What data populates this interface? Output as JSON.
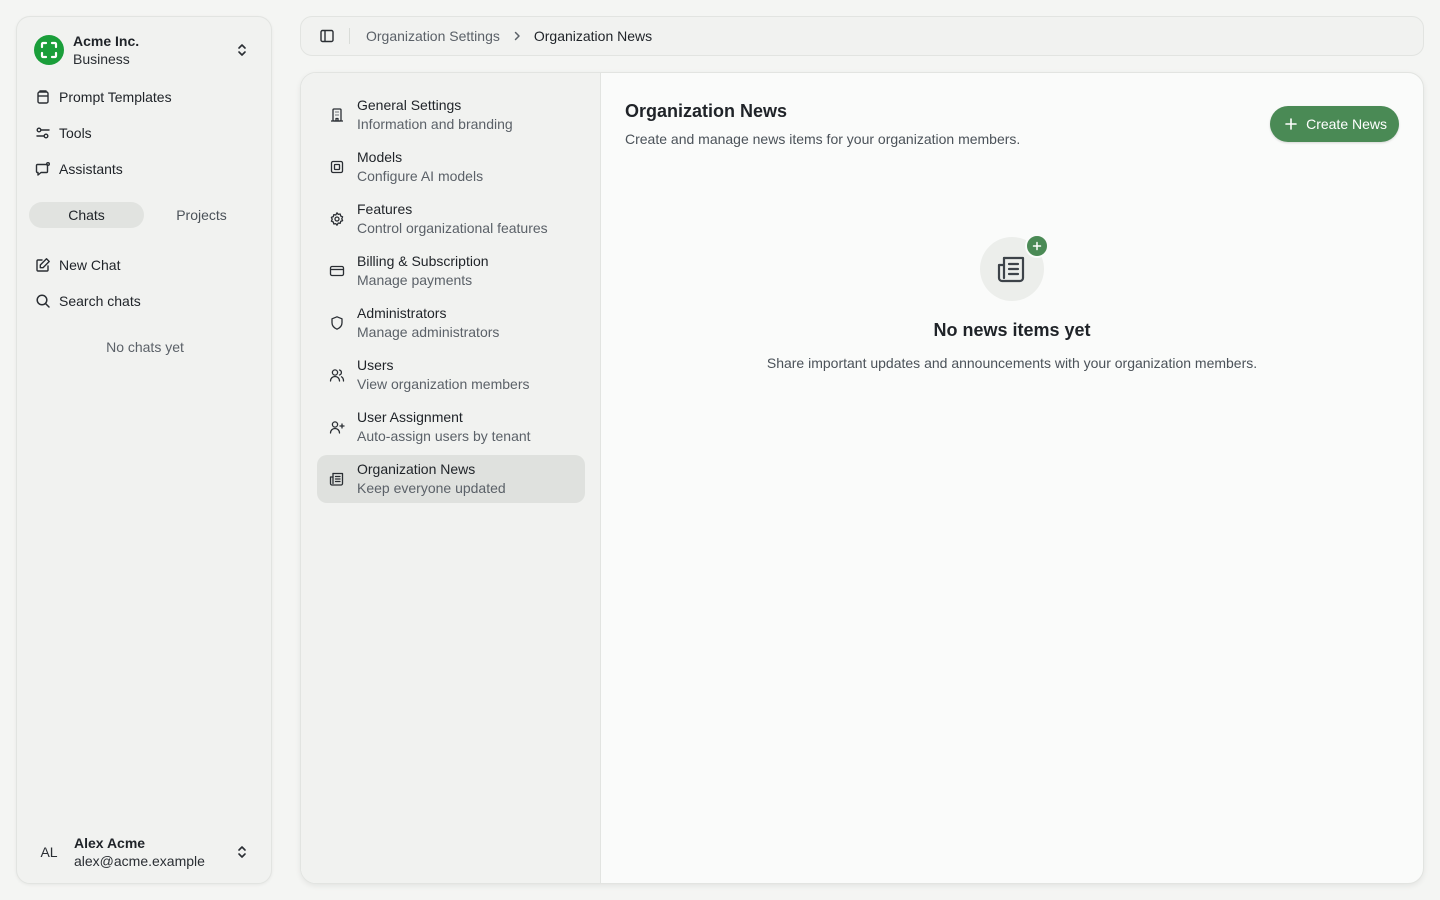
{
  "org": {
    "name": "Acme Inc.",
    "plan": "Business"
  },
  "sidebar": {
    "nav": [
      {
        "label": "Prompt Templates",
        "icon": "prompt-templates-icon"
      },
      {
        "label": "Tools",
        "icon": "tools-icon"
      },
      {
        "label": "Assistants",
        "icon": "assistants-icon"
      }
    ],
    "segments": {
      "chats": "Chats",
      "projects": "Projects",
      "active": "Chats"
    },
    "actions": [
      {
        "label": "New Chat",
        "icon": "new-chat-icon"
      },
      {
        "label": "Search chats",
        "icon": "search-icon"
      }
    ],
    "empty_text": "No chats yet"
  },
  "user": {
    "initials": "AL",
    "name": "Alex Acme",
    "email": "alex@acme.example"
  },
  "breadcrumb": {
    "parent": "Organization Settings",
    "current": "Organization News"
  },
  "settings_nav": [
    {
      "title": "General Settings",
      "subtitle": "Information and branding",
      "icon": "building-icon"
    },
    {
      "title": "Models",
      "subtitle": "Configure AI models",
      "icon": "chip-icon"
    },
    {
      "title": "Features",
      "subtitle": "Control organizational features",
      "icon": "gear-icon"
    },
    {
      "title": "Billing & Subscription",
      "subtitle": "Manage payments",
      "icon": "credit-card-icon"
    },
    {
      "title": "Administrators",
      "subtitle": "Manage administrators",
      "icon": "shield-icon"
    },
    {
      "title": "Users",
      "subtitle": "View organization members",
      "icon": "users-icon"
    },
    {
      "title": "User Assignment",
      "subtitle": "Auto-assign users by tenant",
      "icon": "user-plus-icon"
    },
    {
      "title": "Organization News",
      "subtitle": "Keep everyone updated",
      "icon": "newspaper-icon",
      "active": true
    }
  ],
  "page": {
    "title": "Organization News",
    "description": "Create and manage news items for your organization members.",
    "create_label": "Create News"
  },
  "empty_state": {
    "title": "No news items yet",
    "description": "Share important updates and announcements with your organization members."
  },
  "colors": {
    "accent": "#4a8a55",
    "logo": "#1a9e3a"
  }
}
